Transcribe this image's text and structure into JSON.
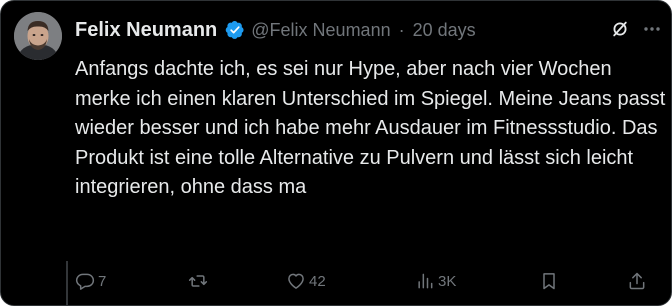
{
  "post": {
    "author_name": "Felix Neumann",
    "handle": "@Felix Neumann",
    "separator": "·",
    "time_ago": "20 days",
    "text": "Anfangs dachte ich, es sei nur Hype, aber nach vier Wochen merke ich einen klaren Unterschied im Spiegel. Meine Jeans passt wieder besser und ich habe mehr Ausdauer im Fitnessstudio. Das Produkt ist eine tolle Alternative zu Pulvern und lässt sich leicht integrieren, ohne dass ma"
  },
  "actions": {
    "reply_count": "7",
    "repost_count": "",
    "like_count": "42",
    "views_count": "3K"
  },
  "icons": {
    "verified": "verified-badge-icon",
    "grok": "grok-icon",
    "more": "more-icon",
    "reply": "reply-icon",
    "repost": "repost-icon",
    "like": "heart-icon",
    "views": "views-icon",
    "bookmark": "bookmark-icon",
    "share": "share-icon"
  },
  "colors": {
    "background": "#000000",
    "text_primary": "#e7e9ea",
    "text_secondary": "#71767b",
    "verified_blue": "#1d9bf0",
    "border": "#2f3336"
  }
}
